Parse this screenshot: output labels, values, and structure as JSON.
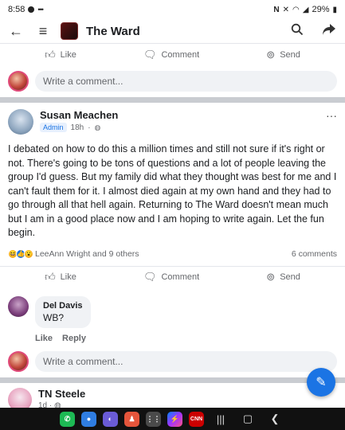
{
  "status_bar": {
    "time": "8:58",
    "battery": "29%"
  },
  "app_bar": {
    "title": "The Ward"
  },
  "prev_post": {
    "actions": {
      "like": "Like",
      "comment": "Comment",
      "send": "Send"
    },
    "comment_placeholder": "Write a comment..."
  },
  "post": {
    "author": "Susan Meachen",
    "badge": "Admin",
    "time": "18h",
    "more": "···",
    "body": "I debated on how to do this a million times and still not sure if it's right or not. There's going to be tons of questions and a lot of people leaving the group I'd guess. But my family did what they thought was best for me and I can't fault them for it. I almost died again at my own hand and they had to go through all that hell again. Returning to The Ward doesn't mean much but I am in a good place now and I am hoping to write again. Let the fun begin.",
    "reactions_text": "LeeAnn Wright and 9 others",
    "comments_count": "6 comments",
    "actions": {
      "like": "Like",
      "comment": "Comment",
      "send": "Send"
    },
    "comments": [
      {
        "name": "Del Davis",
        "text": "WB?",
        "like": "Like",
        "reply": "Reply"
      }
    ],
    "comment_placeholder": "Write a comment..."
  },
  "next_post": {
    "author": "TN Steele",
    "time": "1d"
  },
  "nav": {
    "cnn_label": "CNN"
  },
  "colors": {
    "accent": "#1b74e4",
    "divider": "#c9ccd1"
  }
}
